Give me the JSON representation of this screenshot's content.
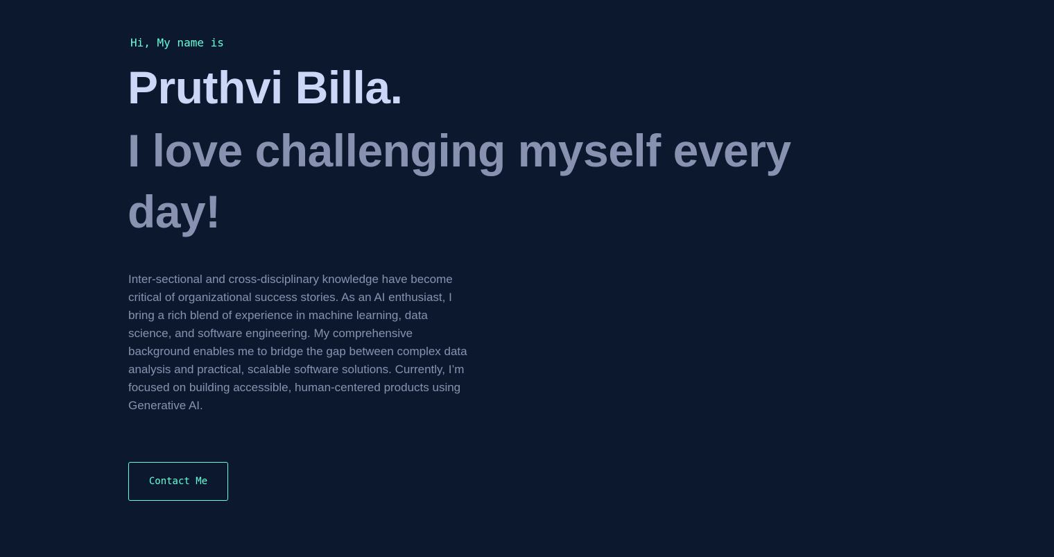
{
  "hero": {
    "greeting": "Hi, My name is",
    "name": "Pruthvi Billa.",
    "tagline": "I love challenging myself every day!",
    "bio": "Inter-sectional and cross-disciplinary knowledge have become critical of organizational success stories. As an AI enthusiast, I bring a rich blend of experience in machine learning, data science, and software engineering. My comprehensive background enables me to bridge the gap between complex data analysis and practical, scalable software solutions. Currently, I’m focused on building accessible, human-centered products using Generative AI.",
    "contact_label": "Contact Me"
  },
  "colors": {
    "background": "#0c182e",
    "accent": "#64ffda",
    "heading": "#ccd6f6",
    "muted": "#8892b0"
  }
}
